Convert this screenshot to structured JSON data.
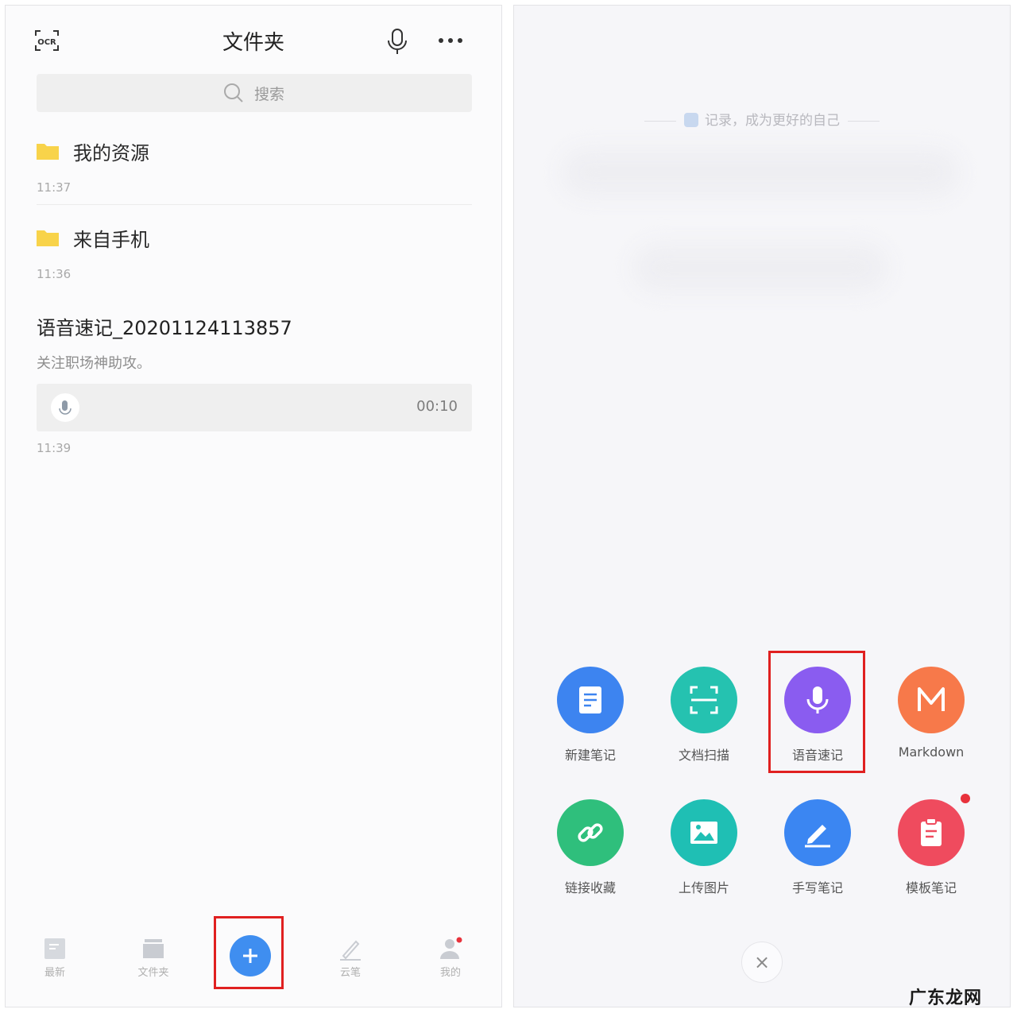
{
  "left": {
    "title": "文件夹",
    "icons": {
      "ocr": "ocr-icon",
      "mic": "microphone-icon",
      "more": "more-horizontal-icon"
    },
    "ocr_text": "OCR",
    "search": {
      "placeholder": "搜索"
    },
    "folders": [
      {
        "name": "我的资源",
        "time": "11:37"
      },
      {
        "name": "来自手机",
        "time": "11:36"
      }
    ],
    "note": {
      "title": "语音速记_20201124113857",
      "body": "关注职场神助攻。",
      "duration": "00:10",
      "time": "11:39"
    },
    "tabs": [
      {
        "label": "最新",
        "icon": "recent-icon"
      },
      {
        "label": "文件夹",
        "icon": "folder-icon"
      },
      {
        "label": "",
        "icon": "plus-icon"
      },
      {
        "label": "云笔",
        "icon": "pen-icon"
      },
      {
        "label": "我的",
        "icon": "user-icon"
      }
    ],
    "colors": {
      "accent": "#3f8ef0",
      "highlight_frame": "#e02020",
      "folder": "#f8d34a"
    }
  },
  "right": {
    "slogan": "记录，成为更好的自己",
    "actions": [
      {
        "label": "新建笔记",
        "icon": "note-icon",
        "color": "#3d84f0"
      },
      {
        "label": "文档扫描",
        "icon": "scan-icon",
        "color": "#25c2b0"
      },
      {
        "label": "语音速记",
        "icon": "microphone-icon",
        "color": "#8a5cf0"
      },
      {
        "label": "Markdown",
        "icon": "markdown-icon",
        "color": "#f7794a"
      },
      {
        "label": "链接收藏",
        "icon": "link-icon",
        "color": "#2fbf7c"
      },
      {
        "label": "上传图片",
        "icon": "image-icon",
        "color": "#1fbfb4"
      },
      {
        "label": "手写笔记",
        "icon": "pencil-icon",
        "color": "#3b86f2"
      },
      {
        "label": "模板笔记",
        "icon": "clipboard-icon",
        "color": "#ef4b5e"
      }
    ],
    "close_symbol": "×"
  },
  "watermark": "广东龙网"
}
